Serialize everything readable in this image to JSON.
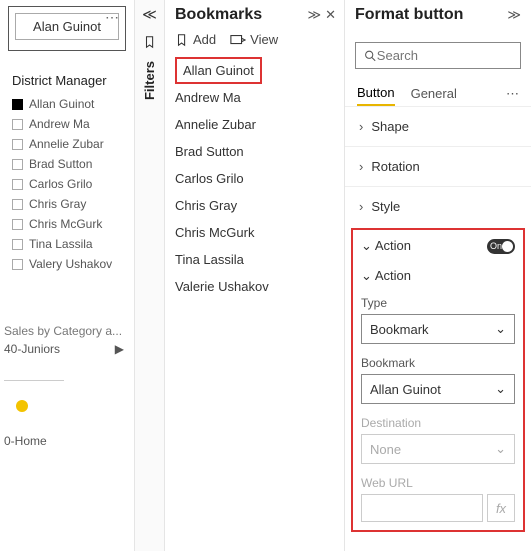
{
  "canvas": {
    "button_visual_label": "Alan Guinot",
    "slicer_title": "District Manager",
    "slicer_items": [
      "Allan Guinot",
      "Andrew Ma",
      "Annelie Zubar",
      "Brad Sutton",
      "Carlos Grilo",
      "Chris Gray",
      "Chris McGurk",
      "Tina Lassila",
      "Valery Ushakov"
    ],
    "below_label_1": "Sales by Category a...",
    "below_nav_1": "40-Juniors",
    "below_nav_2": "0-Home"
  },
  "filters": {
    "label": "Filters"
  },
  "bookmarks": {
    "title": "Bookmarks",
    "add_label": "Add",
    "view_label": "View",
    "items": [
      "Allan Guinot",
      "Andrew Ma",
      "Annelie Zubar",
      "Brad Sutton",
      "Carlos Grilo",
      "Chris Gray",
      "Chris McGurk",
      "Tina Lassila",
      "Valerie Ushakov"
    ]
  },
  "format": {
    "title": "Format button",
    "search_placeholder": "Search",
    "tabs": {
      "button": "Button",
      "general": "General"
    },
    "sections": {
      "shape": "Shape",
      "rotation": "Rotation",
      "style": "Style"
    },
    "action": {
      "header": "Action",
      "toggle_label": "On",
      "sub_header": "Action",
      "type_label": "Type",
      "type_value": "Bookmark",
      "bookmark_label": "Bookmark",
      "bookmark_value": "Allan Guinot",
      "destination_label": "Destination",
      "destination_value": "None",
      "weburl_label": "Web URL",
      "fx_label": "fx"
    }
  }
}
